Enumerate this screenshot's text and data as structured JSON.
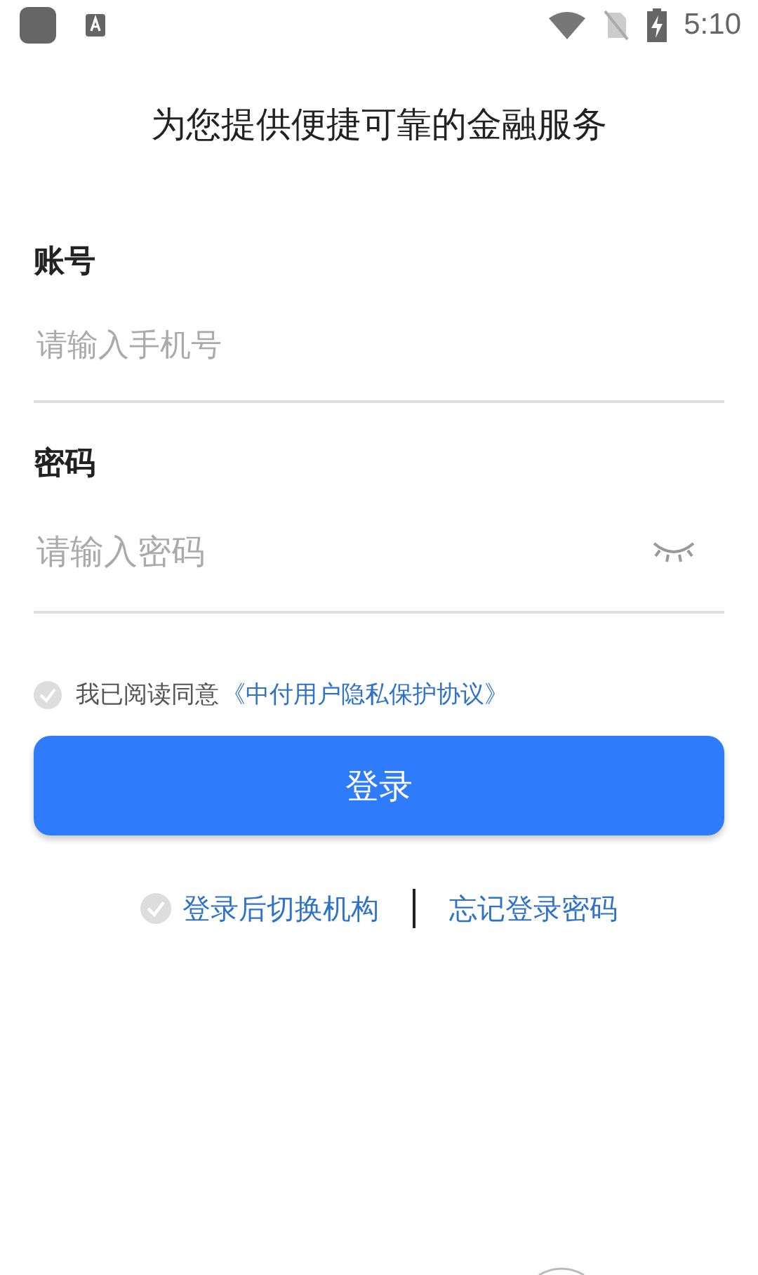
{
  "status_bar": {
    "time": "5:10"
  },
  "subtitle": "为您提供便捷可靠的金融服务",
  "fields": [
    {
      "label": "账号",
      "placeholder": "请输入手机号",
      "kind": "text"
    },
    {
      "label": "密码",
      "placeholder": "请输入密码",
      "kind": "password",
      "password_visible": false
    }
  ],
  "agreement": {
    "checked": false,
    "text": "我已阅读同意",
    "link": "《中付用户隐私保护协议》"
  },
  "login_button": "登录",
  "switch_org": {
    "checked": false,
    "label": "登录后切换机构"
  },
  "forgot_password": "忘记登录密码"
}
